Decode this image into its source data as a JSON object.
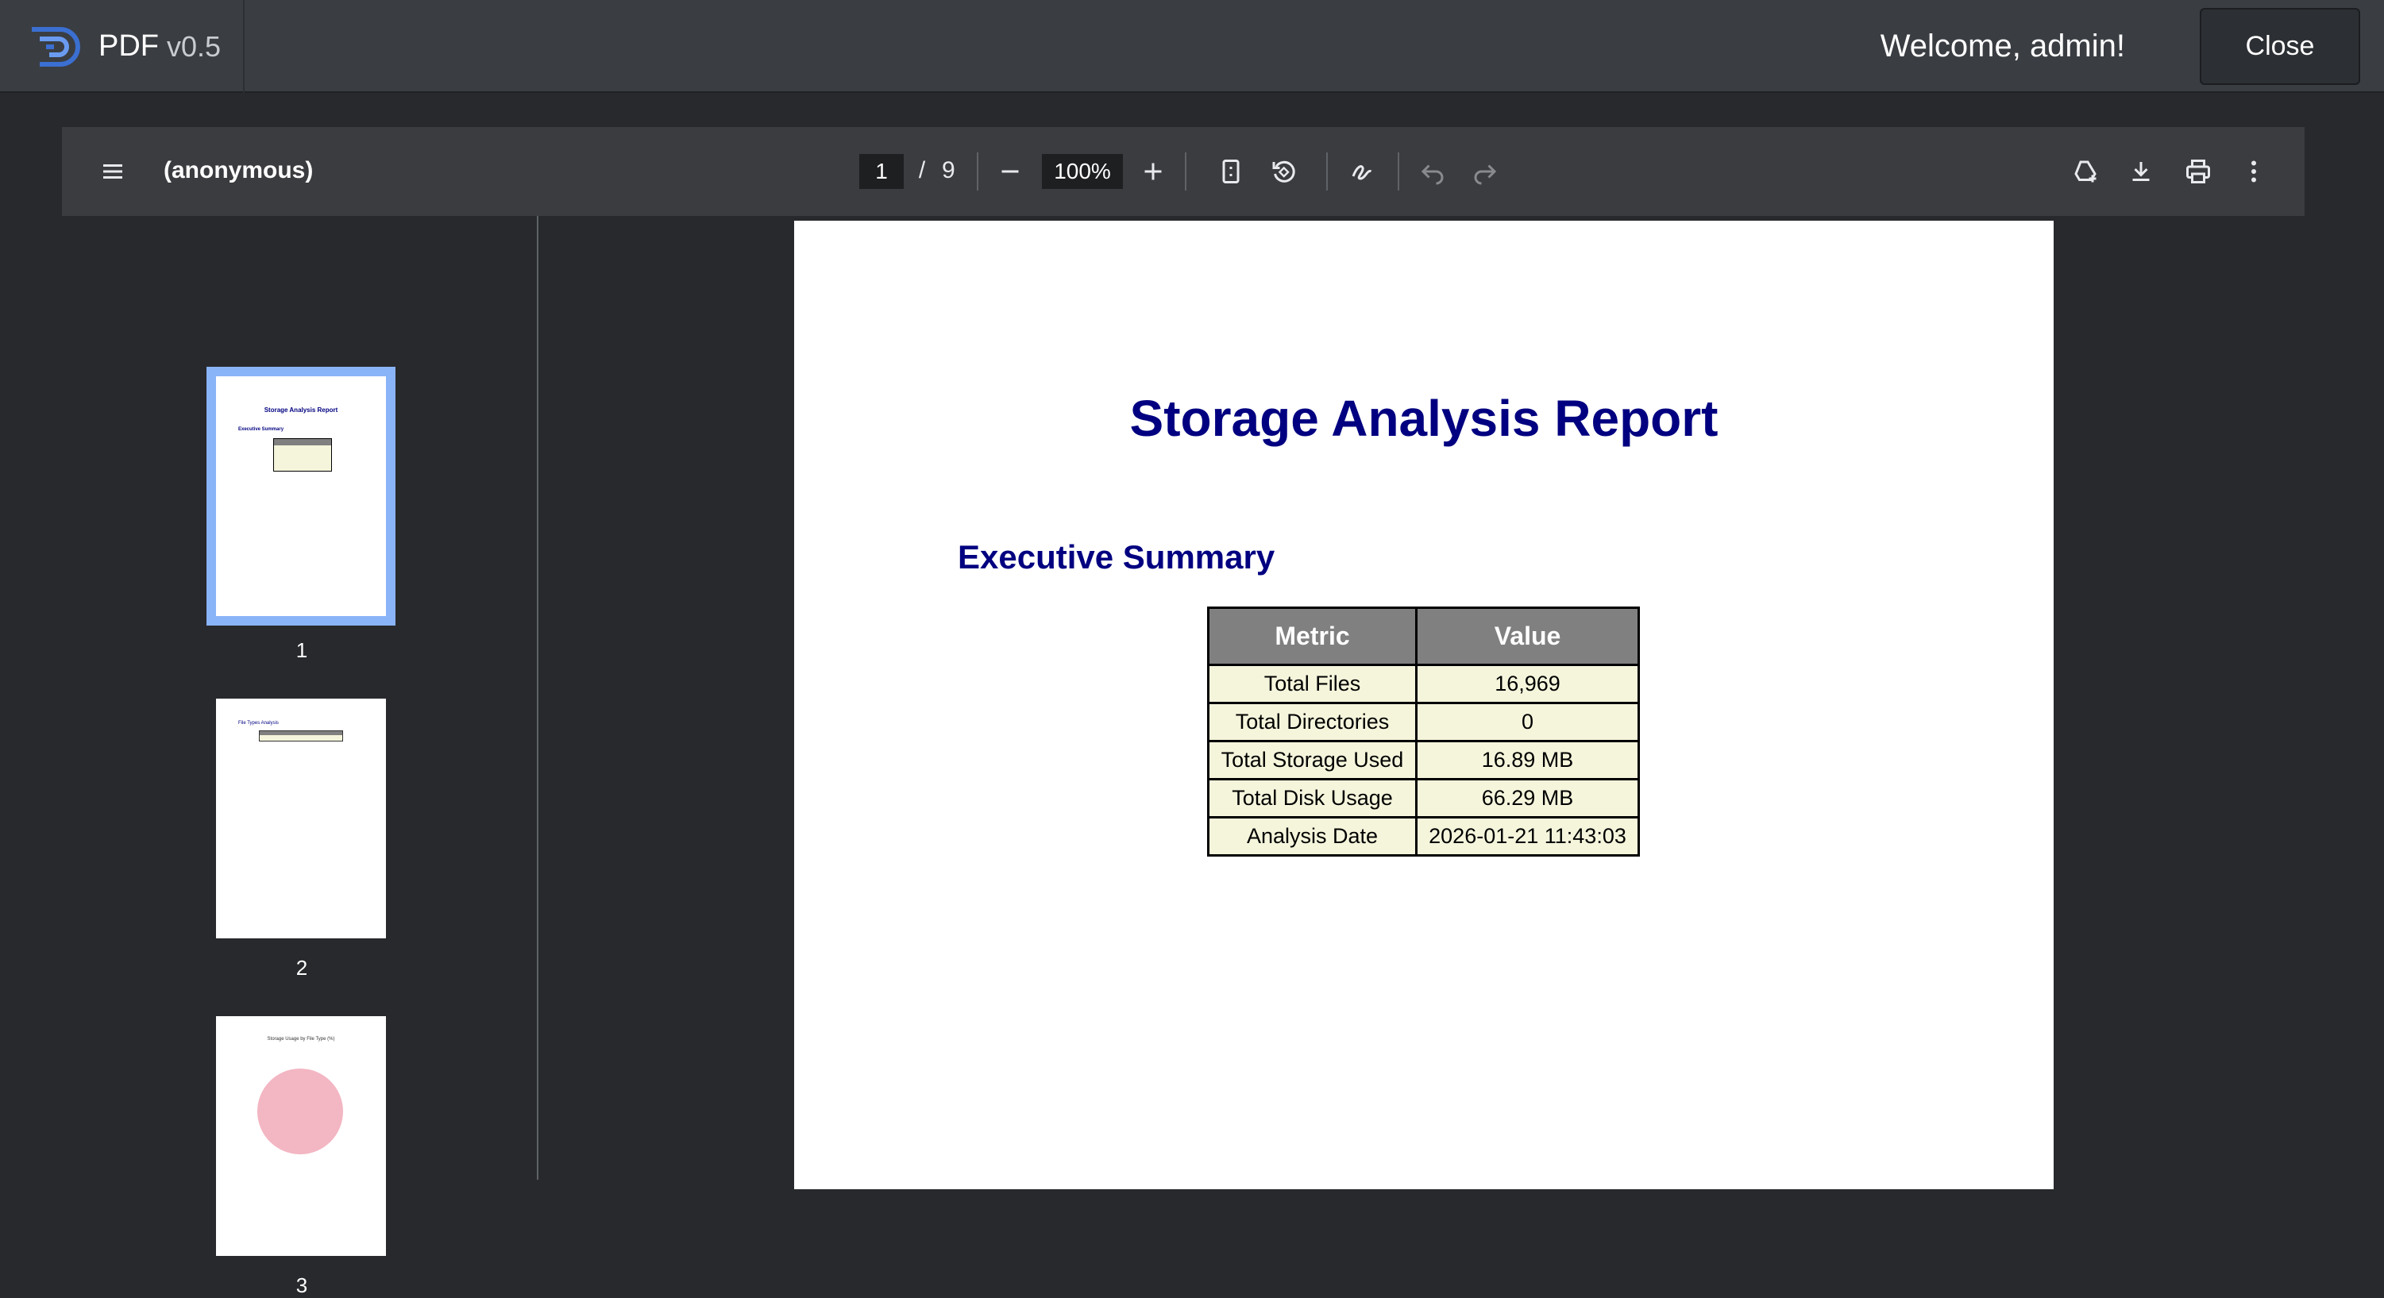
{
  "app": {
    "name": "PDF",
    "version": "v0.5",
    "welcome": "Welcome, admin!",
    "close_label": "Close"
  },
  "toolbar": {
    "doc_title": "(anonymous)",
    "current_page": "1",
    "page_separator": "/",
    "total_pages": "9",
    "zoom": "100%"
  },
  "thumbnails": [
    {
      "label": "1",
      "selected": true,
      "mini_title": "Storage Analysis Report",
      "mini_heading": "Executive Summary"
    },
    {
      "label": "2",
      "selected": false,
      "mini_heading": "File Types Analysis"
    },
    {
      "label": "3",
      "selected": false,
      "mini_heading": "Storage Usage by File Type (%)"
    }
  ],
  "page": {
    "title": "Storage Analysis Report",
    "heading": "Executive Summary",
    "table": {
      "headers": [
        "Metric",
        "Value"
      ],
      "rows": [
        [
          "Total Files",
          "16,969"
        ],
        [
          "Total Directories",
          "0"
        ],
        [
          "Total Storage Used",
          "16.89 MB"
        ],
        [
          "Total Disk Usage",
          "66.29 MB"
        ],
        [
          "Analysis Date",
          "2026-01-21 11:43:03"
        ]
      ]
    }
  },
  "colors": {
    "header_bg": "#3a3d42",
    "toolbar_bg": "#3b3c3f",
    "viewer_bg": "#27292c",
    "selection": "#8ab4f8",
    "title_navy": "#000080",
    "table_header": "#808080",
    "table_cell": "#f5f5dc"
  }
}
